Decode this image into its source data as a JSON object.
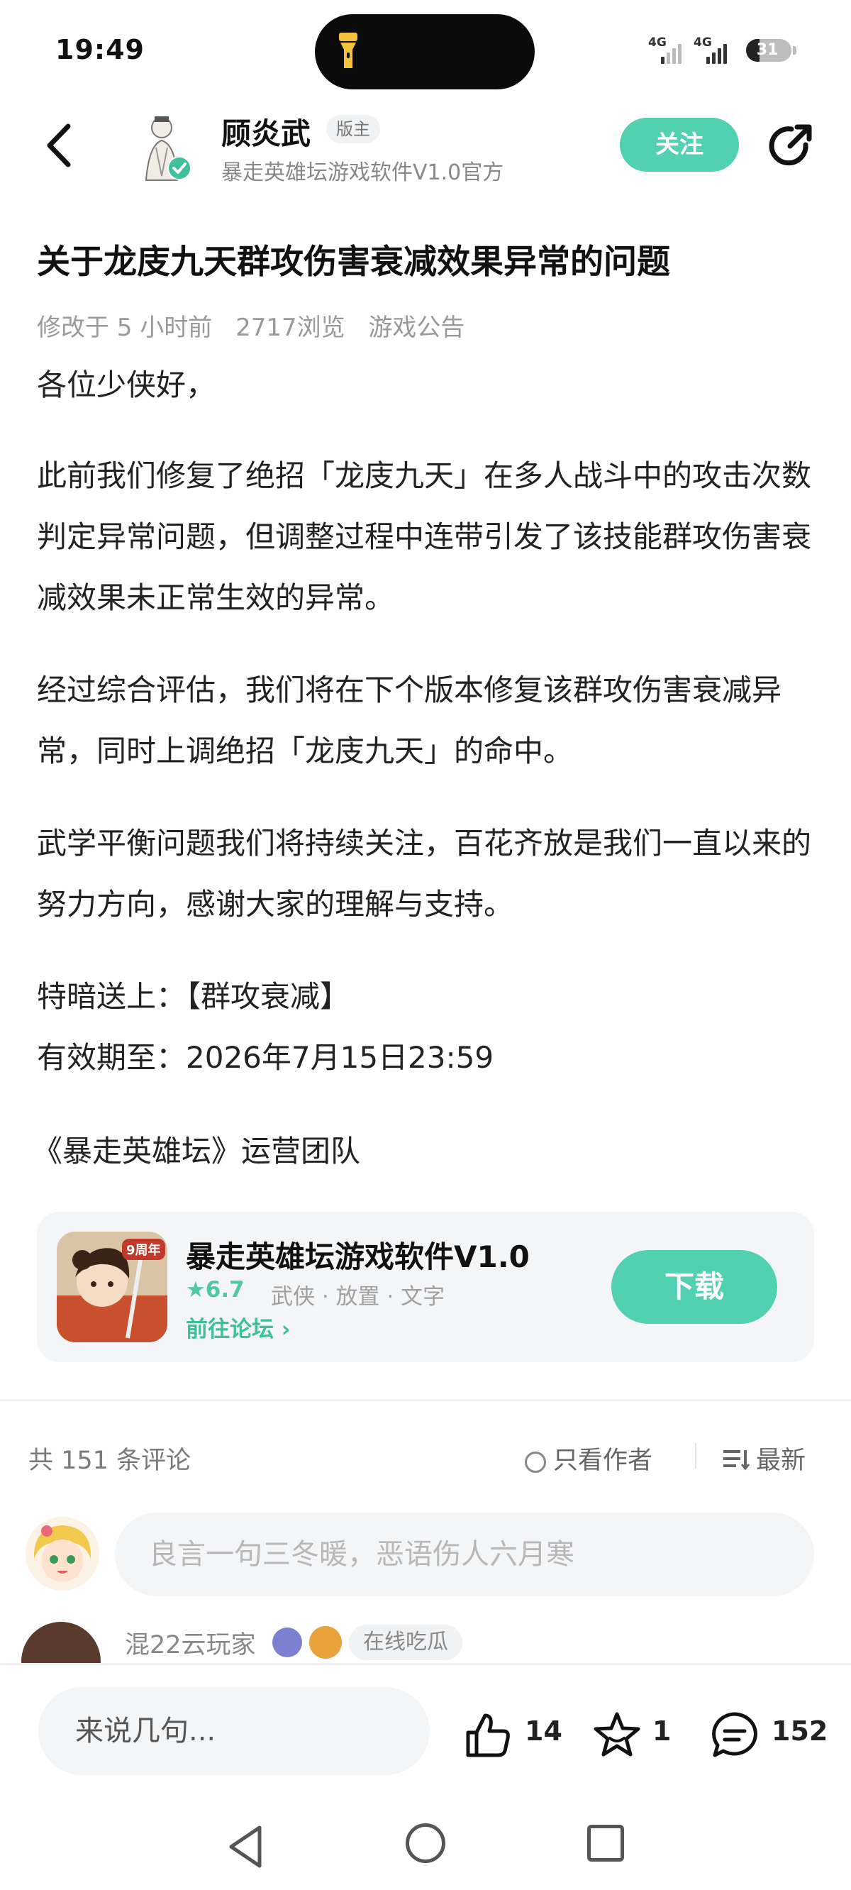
{
  "status_bar": {
    "time": "19:49",
    "sim1": "4G",
    "sim2": "4G",
    "battery": "31"
  },
  "header": {
    "author_name": "顾炎武",
    "author_role": "版主",
    "author_subtitle": "暴走英雄坛游戏软件V1.0官方",
    "follow_label": "关注"
  },
  "article": {
    "title": "关于龙庋九天群攻伤害衰减效果异常的问题",
    "meta": {
      "modified": "修改于 5 小时前",
      "views": "2717浏览",
      "category": "游戏公告"
    },
    "paragraphs": [
      "各位少侠好，",
      "此前我们修复了绝招「龙庋九天」在多人战斗中的攻击次数判定异常问题，但调整过程中连带引发了该技能群攻伤害衰减效果未正常生效的异常。",
      "经过综合评估，我们将在下个版本修复该群攻伤害衰减异常，同时上调绝招「龙庋九天」的命中。",
      "武学平衡问题我们将持续关注，百花齐放是我们一直以来的努力方向，感谢大家的理解与支持。",
      "特暗送上：【群攻衰减】",
      "有效期至：2026年7月15日23:59",
      "《暴走英雄坛》运营团队"
    ]
  },
  "game_card": {
    "name": "暴走英雄坛游戏软件V1.0",
    "rating": "★6.7",
    "tags": "武侠 · 放置 · 文字",
    "forum_link": "前往论坛 ›",
    "download_label": "下载",
    "icon_badge": "9周年"
  },
  "comments": {
    "count_label": "共 151 条评论",
    "only_author_label": "只看作者",
    "sort_label": "最新",
    "input_placeholder": "良言一句三冬暖，恶语伤人六月寒",
    "first_commenter": {
      "name": "混22云玩家",
      "tag": "在线吃瓜"
    }
  },
  "bottom_bar": {
    "reply_placeholder": "来说几句...",
    "likes": "14",
    "favorites": "1",
    "comments": "152"
  },
  "colors": {
    "accent": "#52d1b2",
    "accent_text": "#3fbf9b"
  }
}
